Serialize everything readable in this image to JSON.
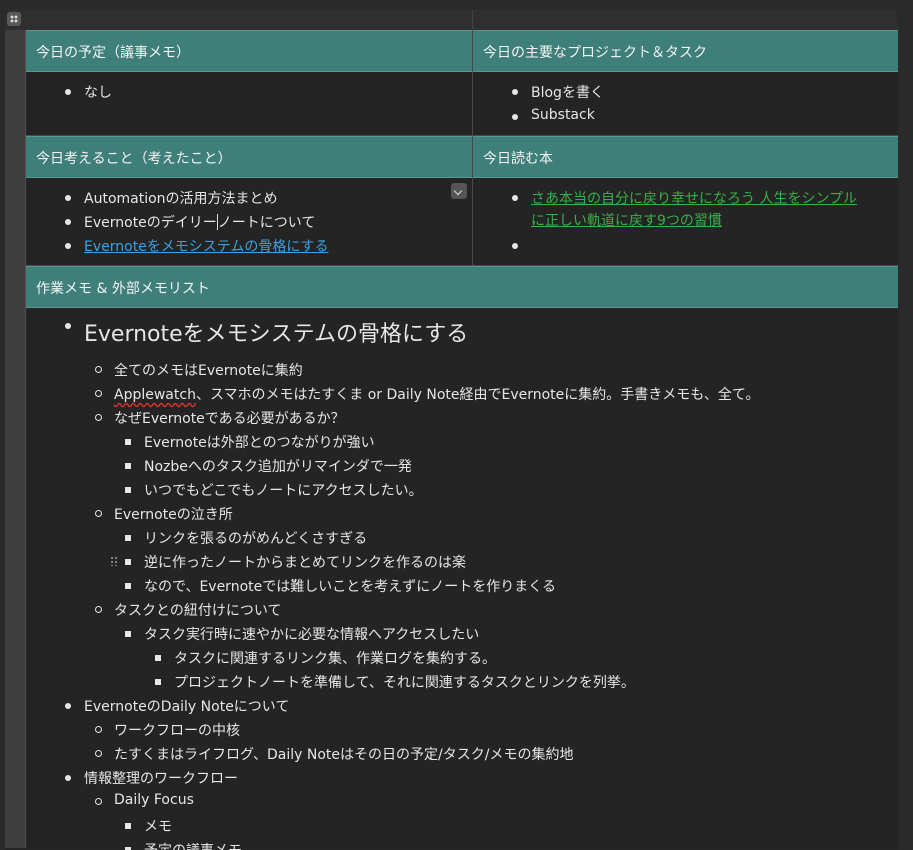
{
  "table": {
    "headers": {
      "schedule": "今日の予定（議事メモ）",
      "projects": "今日の主要なプロジェクト＆タスク",
      "thoughts": "今日考えること（考えたこと）",
      "reading": "今日読む本",
      "worklog": "作業メモ & 外部メモリスト"
    },
    "schedule_items": [
      "なし"
    ],
    "projects_items": [
      "Blogを書く",
      "Substack"
    ],
    "thoughts_items": [
      "Automationの活用方法まとめ",
      "Evernoteのデイリー",
      "ノートについて",
      "Evernoteをメモシステムの骨格にする"
    ],
    "reading_items": [
      "さあ本当の自分に戻り幸せになろう 人生をシンプルに正しい軌道に戻す9つの習慣",
      ""
    ]
  },
  "worklog": {
    "title": "Evernoteをメモシステムの骨格にする",
    "l1a": "全てのメモはEvernoteに集約",
    "l1b_word": "Applewatch",
    "l1b_rest": "、スマホのメモはたすくま or Daily Note経由でEvernoteに集約。手書きメモも、全て。",
    "l1c": "なぜEvernoteである必要があるか？",
    "l1c_1": "Evernoteは外部とのつながりが強い",
    "l1c_2": "Nozbeへのタスク追加がリマインダで一発",
    "l1c_3": "いつでもどこでもノートにアクセスしたい。",
    "l1d": "Evernoteの泣き所",
    "l1d_1": "リンクを張るのがめんどくさすぎる",
    "l1d_2": "逆に作ったノートからまとめてリンクを作るのは楽",
    "l1d_3": "なので、Evernoteでは難しいことを考えずにノートを作りまくる",
    "l1e": "タスクとの紐付けについて",
    "l1e_1": "タスク実行時に速やかに必要な情報へアクセスしたい",
    "l1e_1a": "タスクに関連するリンク集、作業ログを集約する。",
    "l1e_1b": "プロジェクトノートを準備して、それに関連するタスクとリンクを列挙。",
    "item2": "EvernoteのDaily Noteについて",
    "item2_1": "ワークフローの中核",
    "item2_2": "たすくまはライフログ、Daily Noteはその日の予定/タスク/メモの集約地",
    "item3": "情報整理のワークフロー",
    "item3_1": "Daily Focus",
    "item3_1a": "メモ",
    "item3_1b": "予定の議事メモ"
  },
  "colors": {
    "header_bg": "#3f7f79",
    "link_blue": "#3aa3e3",
    "link_green": "#38b04a",
    "cell_bg": "#242424"
  }
}
